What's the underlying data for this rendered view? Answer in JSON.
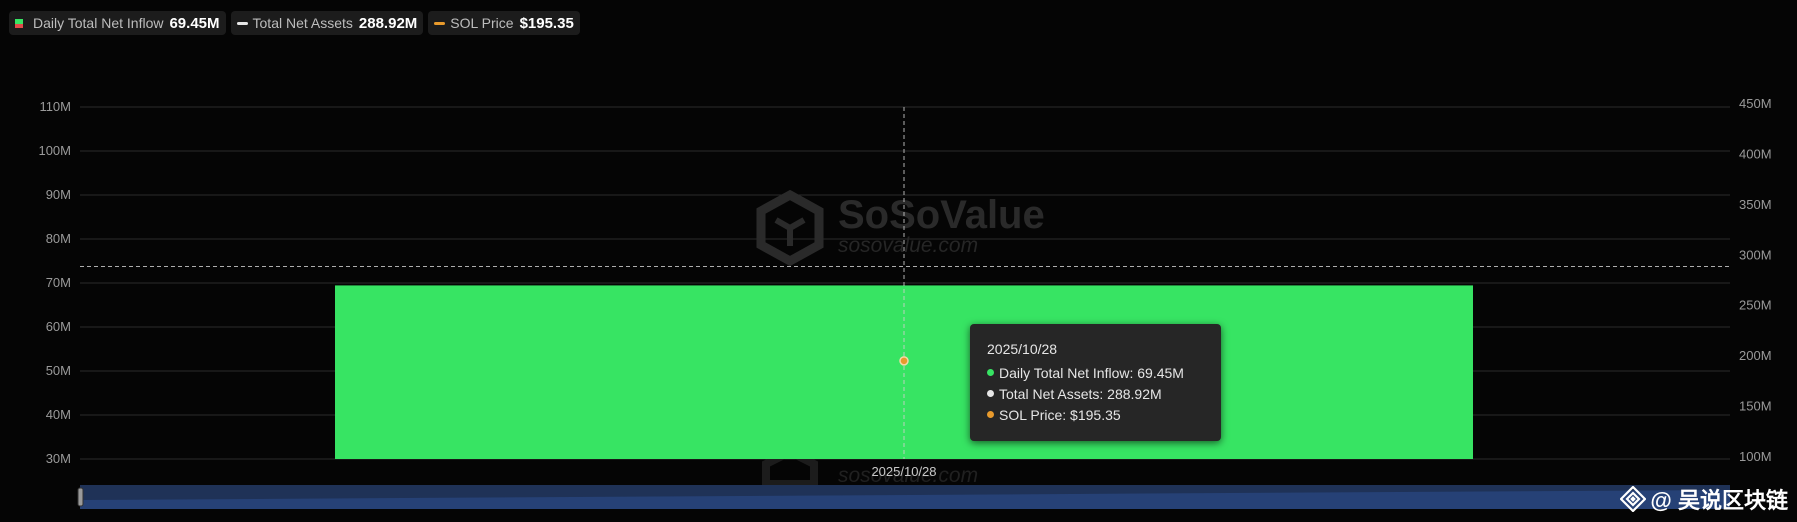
{
  "legend": [
    {
      "label": "Daily Total Net Inflow",
      "value": "69.45M",
      "icon": "bar-swatch"
    },
    {
      "label": "Total Net Assets",
      "value": "288.92M",
      "icon": "line-swatch",
      "color": "#e6e6e6"
    },
    {
      "label": "SOL Price",
      "value": "$195.35",
      "icon": "line-swatch",
      "color": "#e89a2c"
    }
  ],
  "watermark": {
    "brand": "SoSoValue",
    "url": "sosovalue.com"
  },
  "tooltip": {
    "date": "2025/10/28",
    "rows": [
      {
        "text": "Daily Total Net Inflow: 69.45M",
        "color": "#37e463"
      },
      {
        "text": "Total Net Assets: 288.92M",
        "color": "#e6e6e6"
      },
      {
        "text": "SOL Price: $195.35",
        "color": "#e89a2c"
      }
    ]
  },
  "credit": {
    "text": "@ 吴说区块链",
    "icon": "diamond-logo-icon"
  },
  "colors": {
    "inflow": "#37e463",
    "outflow": "#e24a4a",
    "assets": "#e6e6e6",
    "price": "#e89a2c",
    "slider": "#1f3257"
  },
  "chart_data": {
    "type": "bar",
    "categories": [
      "2025/10/28"
    ],
    "series": [
      {
        "name": "Daily Total Net Inflow",
        "values": [
          69.45
        ],
        "unit": "M",
        "axis": "left",
        "kind": "bar"
      },
      {
        "name": "Total Net Assets",
        "values": [
          288.92
        ],
        "unit": "M",
        "axis": "right",
        "kind": "line"
      },
      {
        "name": "SOL Price",
        "values": [
          195.35
        ],
        "unit": "$",
        "axis": "right",
        "kind": "line"
      }
    ],
    "left_axis": {
      "ticks": [
        "110M",
        "100M",
        "90M",
        "80M",
        "70M",
        "60M",
        "50M",
        "40M",
        "30M"
      ],
      "range": [
        30,
        110
      ]
    },
    "right_axis": {
      "ticks": [
        "450M",
        "400M",
        "350M",
        "300M",
        "250M",
        "200M",
        "150M",
        "100M"
      ],
      "range": [
        100,
        450
      ]
    },
    "x_label": "2025/10/28",
    "grid": true,
    "legend_position": "top-left"
  }
}
